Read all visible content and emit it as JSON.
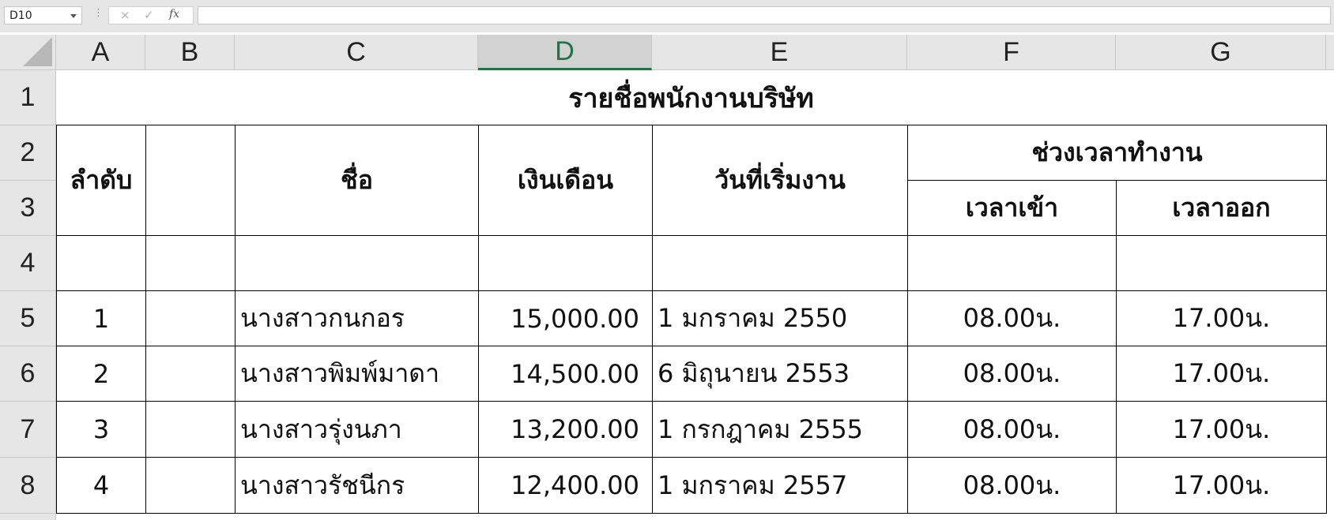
{
  "formula_bar": {
    "name_box": "D10",
    "cancel_icon": "×",
    "enter_icon": "✓",
    "fx_label": "fx",
    "formula": ""
  },
  "columns": [
    "A",
    "B",
    "C",
    "D",
    "E",
    "F",
    "G"
  ],
  "selected_column": "D",
  "rows": [
    "1",
    "2",
    "3",
    "4",
    "5",
    "6",
    "7",
    "8"
  ],
  "sheet": {
    "title": "รายชื่อพนักงานบริษัท",
    "headers": {
      "seq": "ลำดับ",
      "name": "ชื่อ",
      "salary": "เงินเดือน",
      "start_date": "วันที่เริ่มงาน",
      "working_hours": "ช่วงเวลาทำงาน",
      "time_in": "เวลาเข้า",
      "time_out": "เวลาออก"
    },
    "records": [
      {
        "seq": "1",
        "name": "นางสาวกนกอร",
        "salary": "15,000.00",
        "start_date": "1 มกราคม 2550",
        "time_in": "08.00น.",
        "time_out": "17.00น."
      },
      {
        "seq": "2",
        "name": "นางสาวพิมพ์มาดา",
        "salary": "14,500.00",
        "start_date": "6 มิถุนายน 2553",
        "time_in": "08.00น.",
        "time_out": "17.00น."
      },
      {
        "seq": "3",
        "name": "นางสาวรุ่งนภา",
        "salary": "13,200.00",
        "start_date": "1 กรกฎาคม 2555",
        "time_in": "08.00น.",
        "time_out": "17.00น."
      },
      {
        "seq": "4",
        "name": "นางสาวรัชนีกร",
        "salary": "12,400.00",
        "start_date": "1 มกราคม 2557",
        "time_in": "08.00น.",
        "time_out": "17.00น."
      }
    ]
  }
}
